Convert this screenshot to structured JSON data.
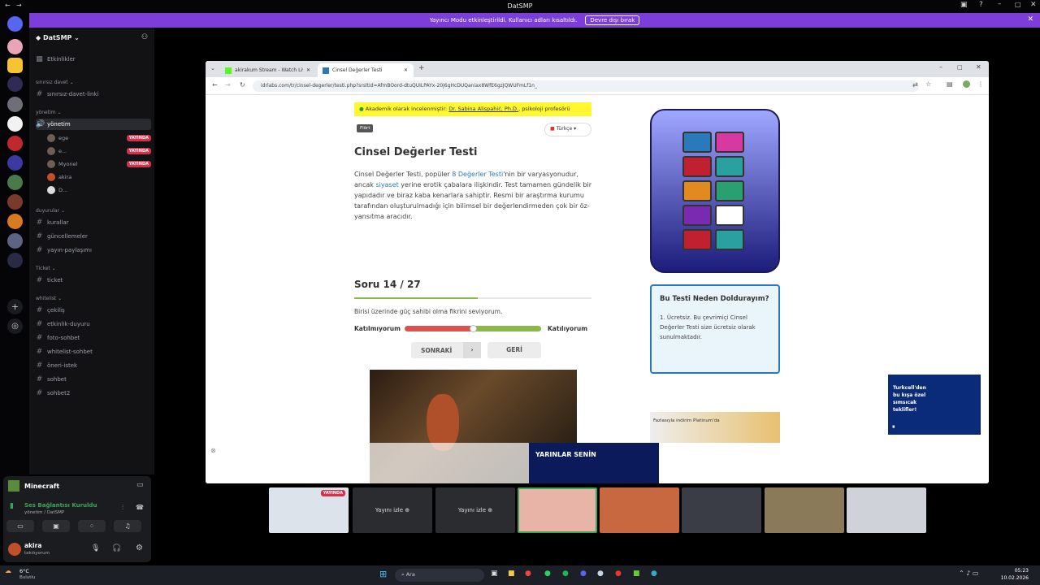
{
  "window": {
    "title": "DatSMP"
  },
  "notice": {
    "text": "Yayıncı Modu etkinleştirildi. Kullanıcı adları kısaltıldı.",
    "button": "Devre dışı bırak"
  },
  "server": {
    "name": "DatSMP",
    "events": "Etkinlikler"
  },
  "categories": {
    "invite": "sınırsız davet",
    "management": "yönetim",
    "announcements": "duyurular",
    "ticket": "Ticket",
    "whitelist": "whitelist"
  },
  "channels": {
    "invite_link": "sınırsız-davet-linki",
    "voice": "yönetim",
    "rules": "kurallar",
    "updates": "güncellemeler",
    "stream_share": "yayın-paylaşımı",
    "ticket": "ticket",
    "giveaway": "çekiliş",
    "event": "etkinlik-duyuru",
    "photo": "foto-sohbet",
    "wl_chat": "whitelist-sohbet",
    "suggest": "öneri-istek",
    "chat": "sohbet",
    "chat2": "sohbet2"
  },
  "voice_users": [
    {
      "name": "ege",
      "live": "YAYINDA"
    },
    {
      "name": "e...",
      "live": "YAYINDA"
    },
    {
      "name": "Myonel",
      "live": "YAYINDA"
    },
    {
      "name": "akira",
      "live": ""
    },
    {
      "name": "D...",
      "live": ""
    }
  ],
  "activity": {
    "game": "Minecraft",
    "status": "Ses Bağlantısı Kuruldu",
    "sub": "yönetim / DatSMP"
  },
  "user": {
    "name": "akira",
    "status": "takılıyorum"
  },
  "browser": {
    "tab1": "akirakum Stream - Watch Live",
    "tab2": "Cinsel Değerler Testi",
    "url": "idrlabs.com/tr/cinsel-degerler/testi.php?srsltid=AfmBOord-dtuQUILPAYx-20j6gHcDUQaniax8WfE6gzJQWUFmLf1n_"
  },
  "page": {
    "academic": "Akademik olarak incelenmiştir: ",
    "academic_link": "Dr. Sabina Alispahić, Ph.D.",
    "academic_tail": ", psikoloji profesörü",
    "flirt": "Flört",
    "lang": "Türkçe",
    "title": "Cinsel Değerler Testi",
    "desc1": "Cinsel Değerler Testi, popüler ",
    "desc_link1": "8 Değerler Testi",
    "desc2": "'nin bir varyasyonudur, ancak ",
    "desc_link2": "siyaset",
    "desc3": " yerine erotik çabalara ilişkindir. Test tamamen gündelik bir yapıdadır ve biraz kaba kenarlara sahiptir. Resmi bir araştırma kurumu tarafından oluşturulmadığı için bilimsel bir değerlendirmeden çok bir öz-yansıtma aracıdır.",
    "question_no": "Soru 14 / 27",
    "question": "Birisi üzerinde güç sahibi olma fikrini seviyorum.",
    "disagree": "Katılmıyorum",
    "agree": "Katılıyorum",
    "next": "SONRAKİ",
    "back": "GERİ",
    "why_title": "Bu Testi Neden Doldurayım?",
    "why_text": "1. Ücretsiz. Bu çevrimiçi Cinsel Değerler Testi size ücretsiz olarak sunulmaktadır.",
    "ad_banner": "YARINLAR SENİN",
    "ad_side": "Turkcell'den bu kışa özel sımsıcak teklifler!",
    "ad_discount": "Fazlasıyla indirim Platinum'da"
  },
  "progress": {
    "fraction": 0.52,
    "slider": 0.5
  },
  "streams": {
    "live_badge": "YAYINDA",
    "watch": "Yayını izle"
  },
  "taskbar": {
    "search": "Ara",
    "weather": "6°C",
    "weather_sub": "Bulutlu",
    "time": "05:23",
    "date": "10.02.2026"
  },
  "colors": {
    "accent": "#7c3ddb",
    "live": "#d8304b",
    "idr_blue": "#2a7ab9",
    "slider_green": "#8bb84a",
    "slider_red": "#d9534f"
  }
}
